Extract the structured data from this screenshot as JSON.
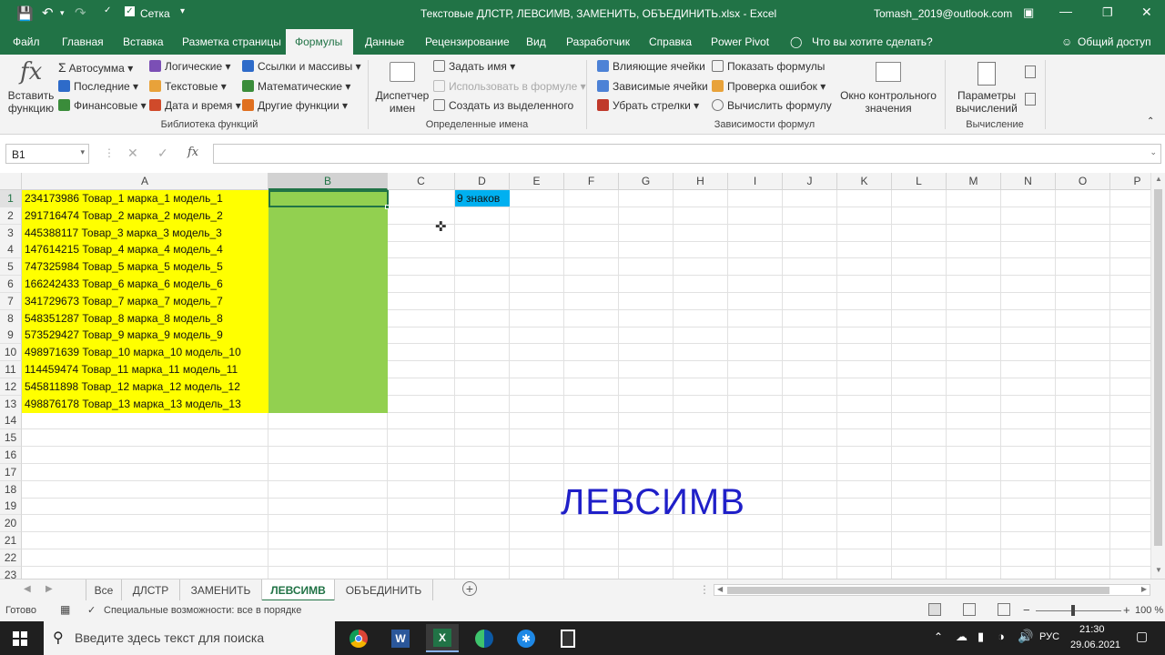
{
  "title_bar": {
    "grid_label": "Сетка",
    "doc_title": "Текстовые ДЛСТР, ЛЕВСИМВ, ЗАМЕНИТЬ, ОБЪЕДИНИТЬ.xlsx  -  Excel",
    "account": "Tomash_2019@outlook.com"
  },
  "ribbon_tabs": [
    "Файл",
    "Главная",
    "Вставка",
    "Разметка страницы",
    "Формулы",
    "Данные",
    "Рецензирование",
    "Вид",
    "Разработчик",
    "Справка",
    "Power Pivot"
  ],
  "ribbon_tabs_active": "Формулы",
  "tell_me": "Что вы хотите сделать?",
  "share": "Общий доступ",
  "ribbon": {
    "insert_function": "Вставить функцию",
    "fn_lib": {
      "autosum": "Автосумма",
      "recent": "Последние",
      "financial": "Финансовые",
      "logical": "Логические",
      "text": "Текстовые",
      "datetime": "Дата и время",
      "lookup": "Ссылки и массивы",
      "math": "Математические",
      "other": "Другие функции",
      "group_label": "Библиотека функций"
    },
    "names": {
      "manager": "Диспетчер имен",
      "define": "Задать имя",
      "use_in_formula": "Использовать в формуле",
      "create_from_sel": "Создать из выделенного",
      "group_label": "Определенные имена"
    },
    "audit": {
      "precedents": "Влияющие ячейки",
      "dependents": "Зависимые ячейки",
      "remove_arrows": "Убрать стрелки",
      "show_formulas": "Показать формулы",
      "error_check": "Проверка ошибок",
      "evaluate": "Вычислить формулу",
      "watch": "Окно контрольного значения",
      "group_label": "Зависимости формул"
    },
    "calc": {
      "options": "Параметры вычислений",
      "group_label": "Вычисление"
    }
  },
  "formula_bar": {
    "name_box": "B1",
    "fx": "fx",
    "value": ""
  },
  "columns": [
    "A",
    "B",
    "C",
    "D",
    "E",
    "F",
    "G",
    "H",
    "I",
    "J",
    "K",
    "L",
    "M",
    "N",
    "O",
    "P"
  ],
  "rows": [
    "1",
    "2",
    "3",
    "4",
    "5",
    "6",
    "7",
    "8",
    "9",
    "10",
    "11",
    "12",
    "13",
    "14",
    "15",
    "16",
    "17",
    "18",
    "19",
    "20",
    "21",
    "22",
    "23"
  ],
  "column_A": [
    "234173986 Товар_1 марка_1 модель_1",
    "291716474 Товар_2 марка_2 модель_2",
    "445388117 Товар_3 марка_3 модель_3",
    "147614215 Товар_4 марка_4 модель_4",
    "747325984 Товар_5 марка_5 модель_5",
    "166242433 Товар_6 марка_6 модель_6",
    "341729673 Товар_7 марка_7 модель_7",
    "548351287 Товар_8 марка_8 модель_8",
    "573529427 Товар_9 марка_9 модель_9",
    "498971639 Товар_10 марка_10 модель_10",
    "114459474 Товар_11 марка_11 модель_11",
    "545811898 Товар_12 марка_12 модель_12",
    "498876178 Товар_13 марка_13 модель_13"
  ],
  "d1_note": "9 знаков",
  "overlay_text": "ЛЕВСИМВ",
  "sheet_tabs": [
    "Все",
    "ДЛСТР",
    "ЗАМЕНИТЬ",
    "ЛЕВСИМВ",
    "ОБЪЕДИНИТЬ"
  ],
  "active_sheet": "ЛЕВСИМВ",
  "status": {
    "ready": "Готово",
    "accessibility": "Специальные возможности: все в порядке",
    "zoom": "100 %"
  },
  "taskbar": {
    "search_placeholder": "Введите здесь текст для поиска",
    "lang": "РУС",
    "time": "21:30",
    "date": "29.06.2021"
  },
  "colors": {
    "excel_green": "#217346",
    "yellow_fill": "#ffff00",
    "green_fill": "#92d050",
    "note_fill": "#00b0f0",
    "overlay_text": "#1f1fc8"
  }
}
